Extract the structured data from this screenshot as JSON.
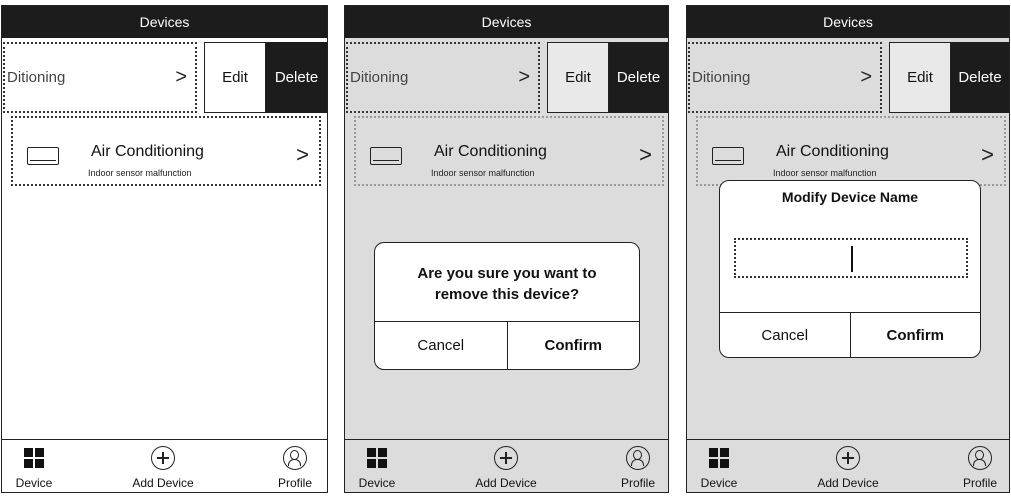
{
  "header": {
    "title": "Devices"
  },
  "swipe_row": {
    "partial_name": "Ditioning",
    "chevron": ">",
    "edit_label": "Edit",
    "delete_label": "Delete"
  },
  "device": {
    "name": "Air Conditioning",
    "status": "Indoor sensor malfunction",
    "icon": "air-conditioner-icon",
    "chevron": ">"
  },
  "remove_dialog": {
    "message": "Are you sure you want to remove this device?",
    "cancel_label": "Cancel",
    "confirm_label": "Confirm"
  },
  "rename_dialog": {
    "title": "Modify Device Name",
    "input_value": "",
    "cancel_label": "Cancel",
    "confirm_label": "Confirm"
  },
  "tabbar": {
    "device_label": "Device",
    "add_label": "Add Device",
    "profile_label": "Profile",
    "device_icon": "grid-icon",
    "add_icon": "plus-circle-icon",
    "profile_icon": "profile-icon"
  },
  "colors": {
    "header_bg": "#1c1c1c",
    "overlay_bg": "#dcdcdc",
    "delete_bg": "#1c1c1c"
  }
}
